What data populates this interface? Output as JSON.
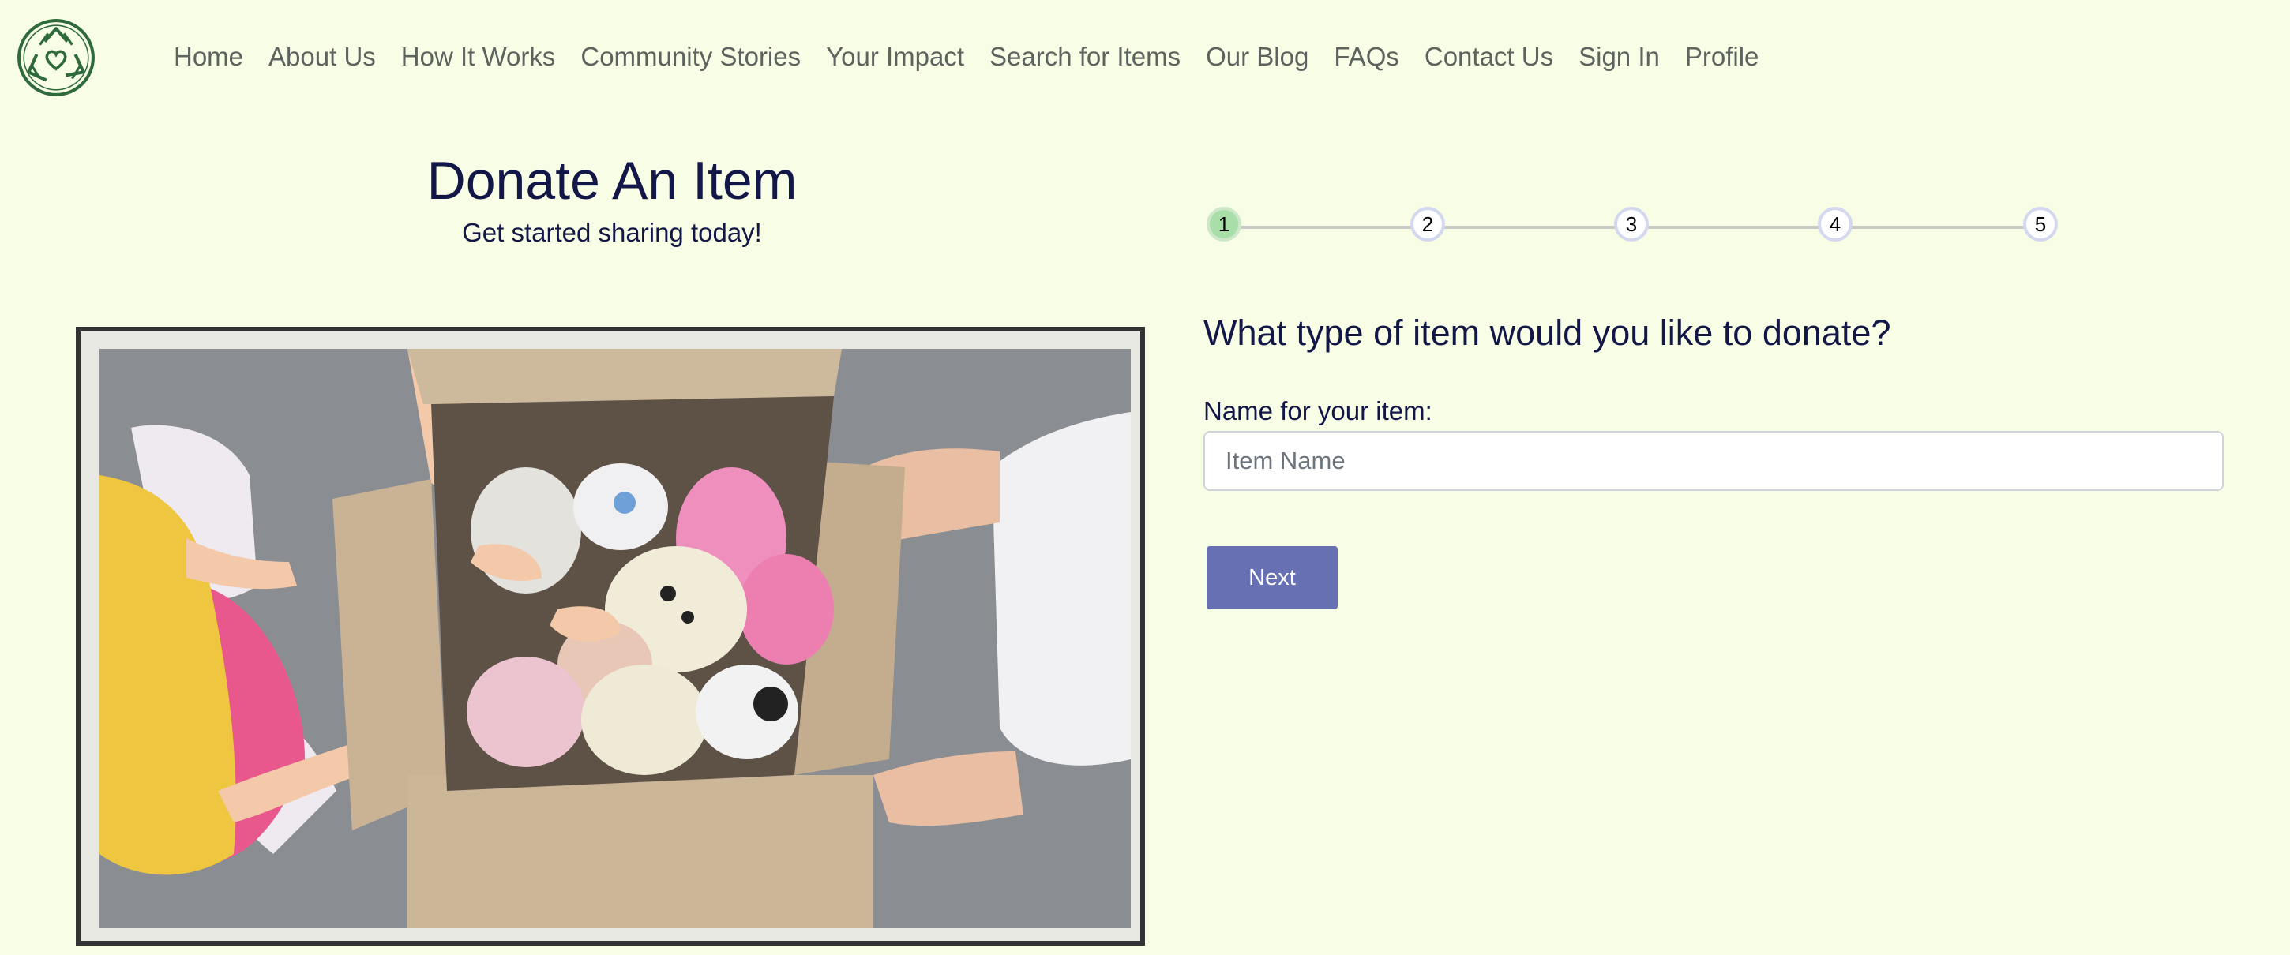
{
  "nav": {
    "logo_icon": "recycle-heart-logo-icon",
    "items": [
      {
        "label": "Home"
      },
      {
        "label": "About Us"
      },
      {
        "label": "How It Works"
      },
      {
        "label": "Community Stories"
      },
      {
        "label": "Your Impact"
      },
      {
        "label": "Search for Items"
      },
      {
        "label": "Our Blog"
      },
      {
        "label": "FAQs"
      },
      {
        "label": "Contact Us"
      },
      {
        "label": "Sign In"
      },
      {
        "label": "Profile"
      }
    ]
  },
  "hero": {
    "title": "Donate An Item",
    "subtitle": "Get started sharing today!",
    "image_icon": "donation-box-photo"
  },
  "stepper": {
    "current_step": 1,
    "steps": [
      "1",
      "2",
      "3",
      "4",
      "5"
    ]
  },
  "form": {
    "question": "What type of item would you like to donate?",
    "name_label": "Name for your item:",
    "name_placeholder": "Item Name",
    "name_value": "",
    "next_label": "Next"
  },
  "colors": {
    "background": "#f8fde6",
    "heading": "#121747",
    "nav_text": "#5d635e",
    "button": "#6670b2",
    "step_active": "#a8dea8",
    "logo": "#2f6b3a"
  }
}
